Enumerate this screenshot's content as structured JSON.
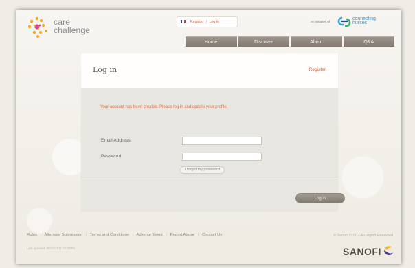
{
  "brand": {
    "line1": "care",
    "line2": "challenge",
    "accent": "#f6a81f",
    "accent_secondary": "#d44a92"
  },
  "header": {
    "language_links": {
      "register": "Register",
      "separator": "|",
      "login": "Log in"
    },
    "initiative": {
      "prefix": "An initiative of",
      "partner_line1": "connecting",
      "partner_line2": "nurses"
    },
    "nav": [
      {
        "label": "Home"
      },
      {
        "label": "Discover"
      },
      {
        "label": "About"
      },
      {
        "label": "Q&A"
      }
    ]
  },
  "main": {
    "title": "Log in",
    "register_link": "Register",
    "notice": "Your account has been created. Please log in and update your profile.",
    "email_label": "Email Address",
    "password_label": "Password",
    "email_value": "",
    "password_value": "",
    "forgot_password": "I forgot my password",
    "login_button": "Log in"
  },
  "footer": {
    "links": [
      "Rules",
      "Alternate Submission",
      "Terms and Conditions",
      "Adverse Event",
      "Report Abuse",
      "Contact Us"
    ],
    "separator": "|",
    "copyright": "© Sanofi 2011 – All Rights Reserved",
    "last_updated": "Last updated: 09/12/2011 02:35PM",
    "sanofi": "SANOFI"
  },
  "colors": {
    "orange": "#df6d3c",
    "nav": "#8f877d",
    "panel": "#e8e6e1"
  }
}
